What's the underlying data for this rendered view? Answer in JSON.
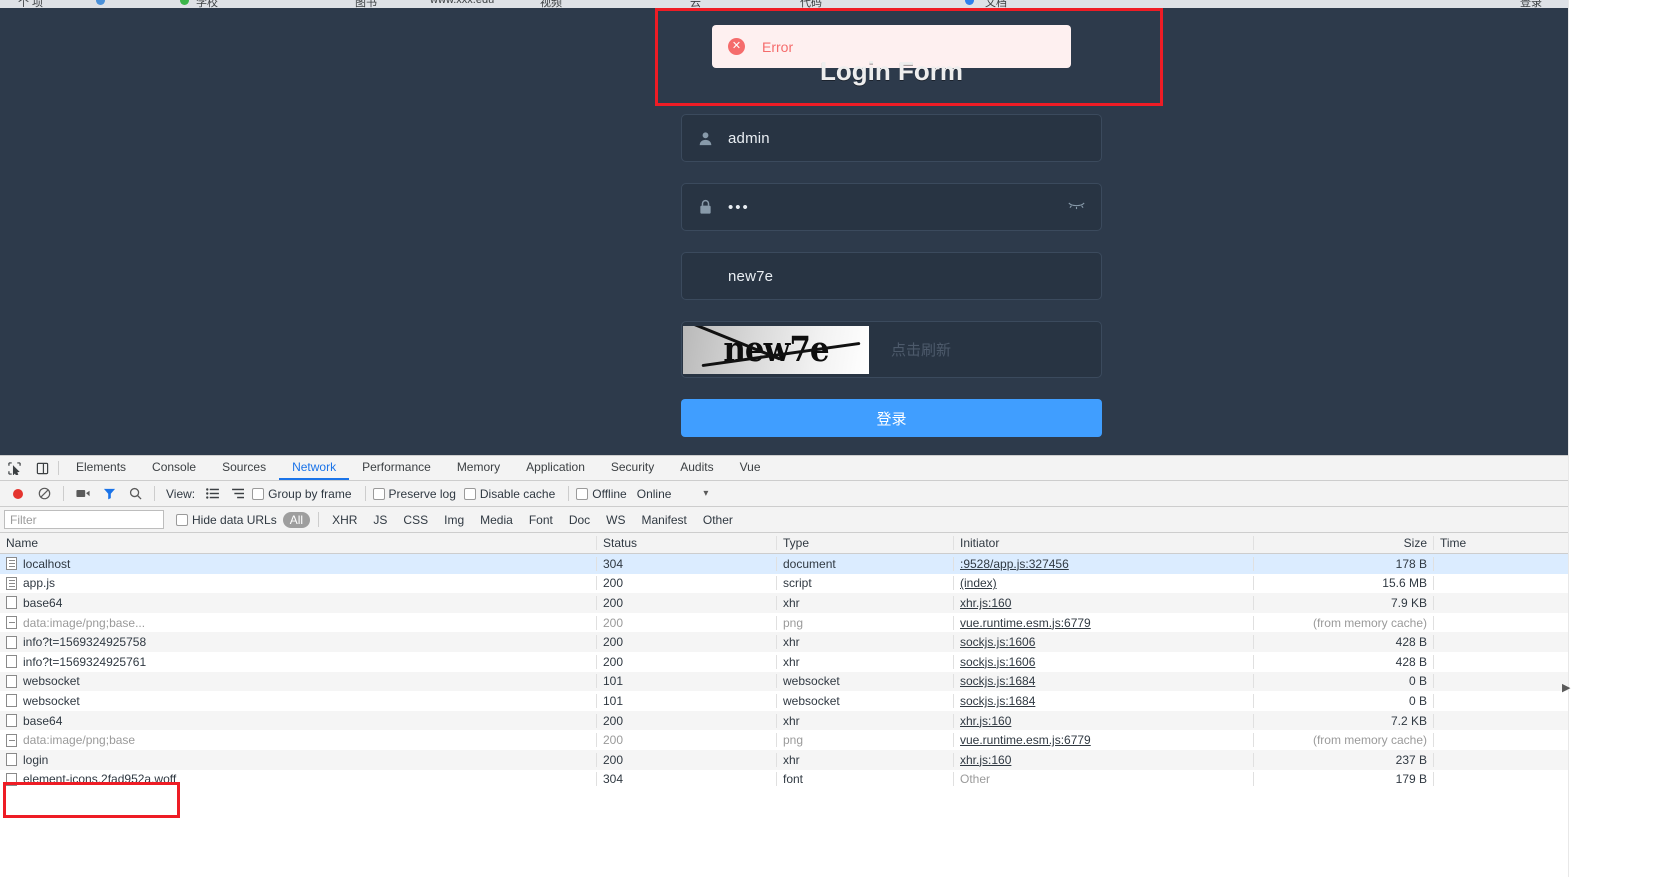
{
  "browser_chrome": {
    "tab_hints": [
      "个 项",
      "学校",
      "云文档",
      "图书馆",
      "视频",
      "代码"
    ]
  },
  "login": {
    "alert": {
      "message": "Error",
      "icon": "error-circle-icon",
      "color": "#f56c6c",
      "bg": "#fef0f0"
    },
    "title": "Login Form",
    "username": {
      "value": "admin",
      "icon": "user-icon"
    },
    "password": {
      "value": "•••",
      "icon": "lock-icon",
      "toggle_icon": "eye-closed-icon"
    },
    "captcha_input": {
      "value": "new7e"
    },
    "captcha_image_text": "new7e",
    "captcha_hint": "点击刷新",
    "submit_label": "登录",
    "accent": "#409eff",
    "page_bg": "#2d3a4b"
  },
  "devtools": {
    "tools": [
      "inspect-element-icon",
      "device-toolbar-icon"
    ],
    "tabs": [
      {
        "label": "Elements",
        "active": false
      },
      {
        "label": "Console",
        "active": false
      },
      {
        "label": "Sources",
        "active": false
      },
      {
        "label": "Network",
        "active": true
      },
      {
        "label": "Performance",
        "active": false
      },
      {
        "label": "Memory",
        "active": false
      },
      {
        "label": "Application",
        "active": false
      },
      {
        "label": "Security",
        "active": false
      },
      {
        "label": "Audits",
        "active": false
      },
      {
        "label": "Vue",
        "active": false
      }
    ],
    "toolbar": {
      "record_icon": "record-circle-icon",
      "clear_icon": "clear-no-entry-icon",
      "capture_screenshots_icon": "camera-icon",
      "filter_icon": "funnel-icon",
      "search_icon": "magnifier-icon",
      "view_label": "View:",
      "view_list_icon": "list-view-icon",
      "view_waterfall_icon": "waterfall-view-icon",
      "group_by_frame": "Group by frame",
      "preserve_log": "Preserve log",
      "disable_cache": "Disable cache",
      "offline": "Offline",
      "online": "Online",
      "throttle_caret": "▾"
    },
    "filterbar": {
      "filter_placeholder": "Filter",
      "filter_value": "",
      "hide_data_urls": "Hide data URLs",
      "types": [
        "All",
        "XHR",
        "JS",
        "CSS",
        "Img",
        "Media",
        "Font",
        "Doc",
        "WS",
        "Manifest",
        "Other"
      ],
      "active_type": "All"
    },
    "table": {
      "columns": [
        "Name",
        "Status",
        "Type",
        "Initiator",
        "Size",
        "Time"
      ],
      "rows": [
        {
          "name": "localhost",
          "status": "304",
          "type": "document",
          "initiator": "9528/app.js:327456",
          "initiator_prefix": ":",
          "size": "178 B",
          "time": "",
          "icon": "document-icon",
          "selected": true,
          "dim": false,
          "link": true
        },
        {
          "name": "app.js",
          "status": "200",
          "type": "script",
          "initiator": "(index)",
          "size": "15.6 MB",
          "time": "",
          "icon": "document-icon",
          "selected": false,
          "dim": false,
          "link": true
        },
        {
          "name": "base64",
          "status": "200",
          "type": "xhr",
          "initiator": "xhr.js:160",
          "size": "7.9 KB",
          "time": "",
          "icon": "plain-icon",
          "selected": false,
          "dim": false,
          "link": true
        },
        {
          "name": "data:image/png;base...",
          "status": "200",
          "type": "png",
          "initiator": "vue.runtime.esm.js:6779",
          "size": "(from memory cache)",
          "time": "",
          "icon": "dash-icon",
          "selected": false,
          "dim": true,
          "link": true
        },
        {
          "name": "info?t=1569324925758",
          "status": "200",
          "type": "xhr",
          "initiator": "sockjs.js:1606",
          "size": "428 B",
          "time": "",
          "icon": "plain-icon",
          "selected": false,
          "dim": false,
          "link": true
        },
        {
          "name": "info?t=1569324925761",
          "status": "200",
          "type": "xhr",
          "initiator": "sockjs.js:1606",
          "size": "428 B",
          "time": "",
          "icon": "plain-icon",
          "selected": false,
          "dim": false,
          "link": true
        },
        {
          "name": "websocket",
          "status": "101",
          "type": "websocket",
          "initiator": "sockjs.js:1684",
          "size": "0 B",
          "time": "",
          "icon": "plain-icon",
          "selected": false,
          "dim": false,
          "link": true
        },
        {
          "name": "websocket",
          "status": "101",
          "type": "websocket",
          "initiator": "sockjs.js:1684",
          "size": "0 B",
          "time": "",
          "icon": "plain-icon",
          "selected": false,
          "dim": false,
          "link": true
        },
        {
          "name": "base64",
          "status": "200",
          "type": "xhr",
          "initiator": "xhr.js:160",
          "size": "7.2 KB",
          "time": "",
          "icon": "plain-icon",
          "selected": false,
          "dim": false,
          "link": true
        },
        {
          "name": "data:image/png;base",
          "status": "200",
          "type": "png",
          "initiator": "vue.runtime.esm.js:6779",
          "size": "(from memory cache)",
          "time": "",
          "icon": "dash-icon",
          "selected": false,
          "dim": true,
          "link": true
        },
        {
          "name": "login",
          "status": "200",
          "type": "xhr",
          "initiator": "xhr.js:160",
          "size": "237 B",
          "time": "",
          "icon": "plain-icon",
          "selected": false,
          "dim": false,
          "link": true
        },
        {
          "name": "element-icons.2fad952a.woff",
          "status": "304",
          "type": "font",
          "initiator": "Other",
          "size": "179 B",
          "time": "",
          "icon": "plain-icon",
          "selected": false,
          "dim": false,
          "link": false
        }
      ]
    }
  },
  "annotations": [
    {
      "name": "error-alert-highlight",
      "color": "#ee1c25"
    },
    {
      "name": "login-request-highlight",
      "color": "#ee1c25"
    }
  ]
}
